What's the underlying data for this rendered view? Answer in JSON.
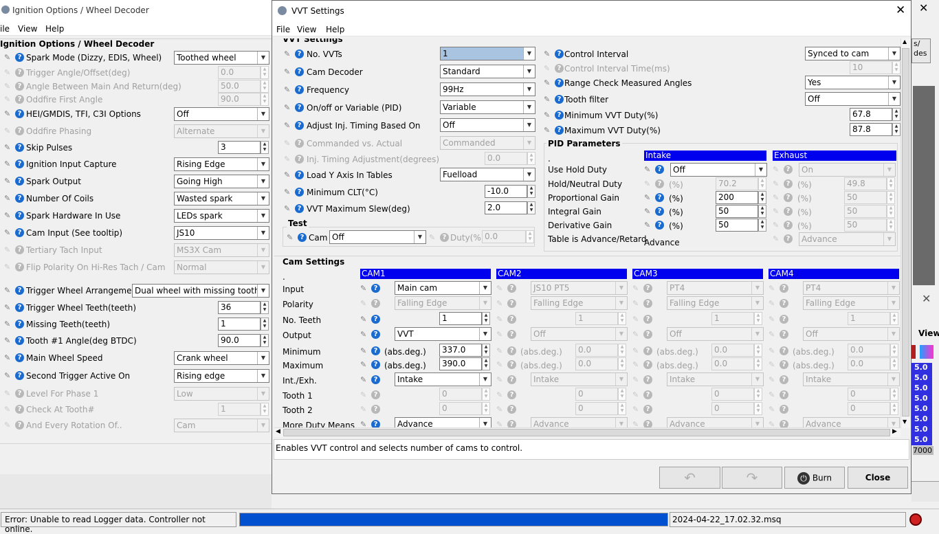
{
  "bg_window": {
    "title": "Ignition Options / Wheel Decoder",
    "menus": [
      "ile",
      "View",
      "Help"
    ],
    "panel_title": "Ignition Options / Wheel Decoder",
    "rows": [
      {
        "label": "Spark Mode (Dizzy, EDIS, Wheel)",
        "value": "Toothed wheel",
        "type": "select",
        "enabled": true
      },
      {
        "label": "Trigger Angle/Offset(deg)",
        "value": "0.0",
        "type": "num",
        "enabled": false
      },
      {
        "label": "Angle Between Main And Return(deg)",
        "value": "50.0",
        "type": "num",
        "enabled": false
      },
      {
        "label": "Oddfire First Angle",
        "value": "90.0",
        "type": "num",
        "enabled": false
      },
      {
        "label": "HEI/GMDIS, TFI, C3I Options",
        "value": "Off",
        "type": "select",
        "enabled": true
      },
      {
        "label": "Oddfire Phasing",
        "value": "Alternate",
        "type": "select",
        "enabled": false
      },
      {
        "label": "Skip Pulses",
        "value": "3",
        "type": "num",
        "enabled": true
      },
      {
        "label": "Ignition Input Capture",
        "value": "Rising Edge",
        "type": "select",
        "enabled": true
      },
      {
        "label": "Spark Output",
        "value": "Going High",
        "type": "select",
        "enabled": true
      },
      {
        "label": "Number Of Coils",
        "value": "Wasted spark",
        "type": "select",
        "enabled": true
      },
      {
        "label": "Spark Hardware In Use",
        "value": "LEDs spark",
        "type": "select",
        "enabled": true
      },
      {
        "label": "Cam Input (See tooltip)",
        "value": "JS10",
        "type": "select",
        "enabled": true
      },
      {
        "label": "Tertiary Tach Input",
        "value": "MS3X Cam",
        "type": "select",
        "enabled": false
      },
      {
        "label": "Flip Polarity On Hi-Res Tach / Cam",
        "value": "Normal",
        "type": "select",
        "enabled": false
      },
      {
        "label": "Trigger Wheel Arrangement",
        "value": "Dual wheel with missing tooth",
        "type": "select",
        "enabled": true
      },
      {
        "label": "Trigger Wheel Teeth(teeth)",
        "value": "36",
        "type": "num",
        "enabled": true
      },
      {
        "label": "Missing Teeth(teeth)",
        "value": "1",
        "type": "num",
        "enabled": true
      },
      {
        "label": "Tooth #1 Angle(deg BTDC)",
        "value": "90.0",
        "type": "num",
        "enabled": true
      },
      {
        "label": "Main Wheel Speed",
        "value": "Crank wheel",
        "type": "select",
        "enabled": true
      },
      {
        "label": "Second Trigger Active On",
        "value": "Rising edge",
        "type": "select",
        "enabled": true
      },
      {
        "label": "Level For Phase 1",
        "value": "Low",
        "type": "select",
        "enabled": false
      },
      {
        "label": "Check At Tooth#",
        "value": "1",
        "type": "num",
        "enabled": false
      },
      {
        "label": "And Every Rotation Of..",
        "value": "Cam",
        "type": "select",
        "enabled": false
      }
    ]
  },
  "right_window": {
    "partial_labels": [
      "s/",
      "des"
    ],
    "view_label": "View",
    "values": [
      "5.0",
      "5.0",
      "5.0",
      "5.0",
      "5.0",
      "5.0",
      "5.0",
      "5.0"
    ],
    "axis_value": "7000"
  },
  "dialog": {
    "title": "VVT Settings",
    "menus": [
      "File",
      "View",
      "Help"
    ],
    "section_title": "VVT Settings",
    "left_rows": [
      {
        "label": "No. VVTs",
        "value": "1",
        "type": "select",
        "enabled": true
      },
      {
        "label": "Cam Decoder",
        "value": "Standard",
        "type": "select",
        "enabled": true
      },
      {
        "label": "Frequency",
        "value": "99Hz",
        "type": "select",
        "enabled": true
      },
      {
        "label": "On/off or Variable (PID)",
        "value": "Variable",
        "type": "select",
        "enabled": true
      },
      {
        "label": "Adjust Inj. Timing Based On",
        "value": "Off",
        "type": "select",
        "enabled": true
      },
      {
        "label": "Commanded vs. Actual",
        "value": "Commanded",
        "type": "select",
        "enabled": false
      },
      {
        "label": "Inj. Timing Adjustment(degrees)",
        "value": "0.0",
        "type": "num",
        "enabled": false
      },
      {
        "label": "Load Y Axis In Tables",
        "value": "Fuelload",
        "type": "select",
        "enabled": true
      },
      {
        "label": "Minimum CLT(°C)",
        "value": "-10.0",
        "type": "num",
        "enabled": true
      },
      {
        "label": "VVT Maximum Slew(deg)",
        "value": "2.0",
        "type": "num",
        "enabled": true
      }
    ],
    "test": {
      "title": "Test",
      "cam_label": "Cam",
      "cam_value": "Off",
      "duty_label": "Duty(%)",
      "duty_value": "0.0"
    },
    "right_rows": [
      {
        "label": "Control Interval",
        "value": "Synced to cam",
        "type": "select",
        "enabled": true
      },
      {
        "label": "Control Interval Time(ms)",
        "value": "10",
        "type": "num",
        "enabled": false
      },
      {
        "label": "Range Check Measured Angles",
        "value": "Yes",
        "type": "select",
        "enabled": true
      },
      {
        "label": "Tooth filter",
        "value": "Off",
        "type": "select",
        "enabled": true
      },
      {
        "label": "Minimum VVT Duty(%)",
        "value": "67.8",
        "type": "num",
        "enabled": true
      },
      {
        "label": "Maximum VVT Duty(%)",
        "value": "87.8",
        "type": "num",
        "enabled": true
      }
    ],
    "pid": {
      "title": "PID Parameters",
      "dot": ".",
      "intake_header": "Intake",
      "exhaust_header": "Exhaust",
      "row_labels": [
        "Use Hold Duty",
        "Hold/Neutral Duty",
        "Proportional Gain",
        "Integral Gain",
        "Derivative Gain",
        "Table is Advance/Retard"
      ],
      "unit": "(%)",
      "intake": {
        "hold": "Off",
        "neutral": "70.2",
        "p": "200",
        "i": "50",
        "d": "50",
        "table": "Advance"
      },
      "exhaust": {
        "hold": "On",
        "neutral": "49.8",
        "p": "50",
        "i": "50",
        "d": "50",
        "table": "Advance"
      }
    },
    "cam_settings": {
      "title": "Cam Settings",
      "dot": ".",
      "row_labels": [
        "Input",
        "Polarity",
        "No. Teeth",
        "Output",
        "Minimum",
        "Maximum",
        "Int./Exh.",
        "Tooth 1",
        "Tooth 2",
        "More Duty Means"
      ],
      "unit": "(abs.deg.)",
      "cams": [
        {
          "header": "CAM1",
          "input": "Main cam",
          "polarity": "Falling Edge",
          "teeth": "1",
          "output": "VVT",
          "min": "337.0",
          "max": "390.0",
          "intexh": "Intake",
          "tooth1": "0",
          "tooth2": "0",
          "more": "Advance"
        },
        {
          "header": "CAM2",
          "input": "JS10 PT5",
          "polarity": "Falling Edge",
          "teeth": "1",
          "output": "Off",
          "min": "0.0",
          "max": "0.0",
          "intexh": "Intake",
          "tooth1": "0",
          "tooth2": "0",
          "more": "Advance"
        },
        {
          "header": "CAM3",
          "input": "PT4",
          "polarity": "Falling Edge",
          "teeth": "1",
          "output": "Off",
          "min": "0.0",
          "max": "0.0",
          "intexh": "Intake",
          "tooth1": "0",
          "tooth2": "0",
          "more": "Advance"
        },
        {
          "header": "CAM4",
          "input": "PT4",
          "polarity": "Falling Edge",
          "teeth": "1",
          "output": "Off",
          "min": "0.0",
          "max": "0.0",
          "intexh": "Intake",
          "tooth1": "0",
          "tooth2": "0",
          "more": "Advance"
        }
      ]
    },
    "help_text": "Enables VVT control and selects number of cams to control.",
    "buttons": {
      "burn": "Burn",
      "close": "Close"
    }
  },
  "status": {
    "error": "Error: Unable to read Logger data. Controller not online.",
    "file": "2024-04-22_17.02.32.msq",
    "progress": 1.0
  },
  "colors": {
    "accent": "#0000ee",
    "progress": "#0050d0",
    "help_icon": "#1a6bd0"
  }
}
